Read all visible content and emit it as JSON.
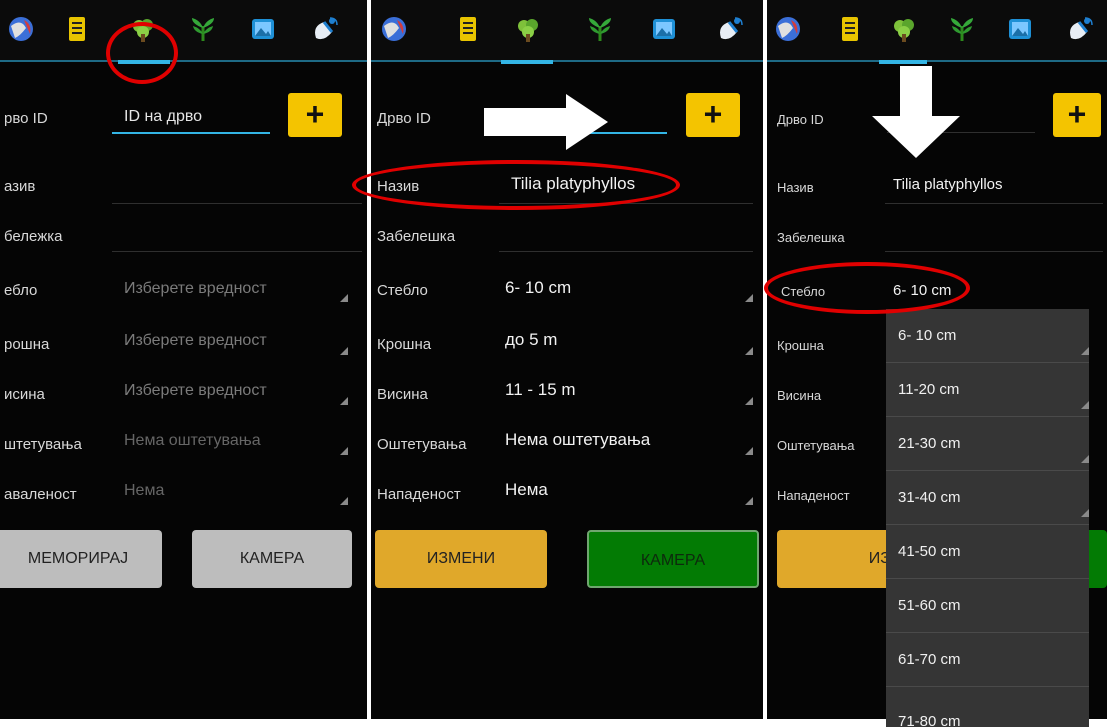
{
  "colors": {
    "accent": "#33b5e5",
    "plus": "#f4c400",
    "yellow_button": "#e0a82a",
    "green_button": "#037b04",
    "grey_button": "#bdbdbd",
    "highlight": "#e00000"
  },
  "tabs": [
    {
      "name": "globe-icon"
    },
    {
      "name": "notes-icon"
    },
    {
      "name": "tree-leaf-icon"
    },
    {
      "name": "plant-icon"
    },
    {
      "name": "image-icon"
    },
    {
      "name": "satellite-icon"
    }
  ],
  "panels": [
    {
      "labels": {
        "tree_id": "рво ID",
        "name": "азив",
        "note": "бележка",
        "trunk": "ебло",
        "crown": "рошна",
        "height": "исина",
        "damage": "штетувања",
        "infestation": "аваленост"
      },
      "tree_id_placeholder": "ID на дрво",
      "name_value": "",
      "trunk_placeholder": "Изберете вредност",
      "crown_placeholder": "Изберете вредност",
      "height_placeholder": "Изберете вредност",
      "damage_placeholder": "Нема оштетувања",
      "infestation_placeholder": "Нема",
      "buttons": {
        "left": "МЕМОРИРАЈ",
        "right": "КАМЕРА"
      }
    },
    {
      "labels": {
        "tree_id": "Дрво ID",
        "name": "Назив",
        "note": "Забелешка",
        "trunk": "Стебло",
        "crown": "Крошна",
        "height": "Висина",
        "damage": "Оштетувања",
        "infestation": "Нападеност"
      },
      "name_value": "Tilia platyphyllos",
      "trunk_value": "6- 10 cm",
      "crown_value": "до 5 m",
      "height_value": "11 - 15 m",
      "damage_value": "Нема оштетувања",
      "infestation_value": "Нема",
      "buttons": {
        "left": "ИЗМЕНИ",
        "right": "КАМЕРА"
      }
    },
    {
      "labels": {
        "tree_id": "Дрво ID",
        "name": "Назив",
        "note": "Забелешка",
        "trunk": "Стебло",
        "crown": "Крошна",
        "height": "Висина",
        "damage": "Оштетувања",
        "infestation": "Нападеност"
      },
      "name_value": "Tilia platyphyllos",
      "trunk_value": "6- 10 cm",
      "buttons": {
        "left": "ИЗМЕНИ"
      },
      "dropdown_options": [
        "6- 10 cm",
        "11-20 cm",
        "21-30 cm",
        "31-40 cm",
        "41-50 cm",
        "51-60 cm",
        "61-70 cm",
        "71-80 cm"
      ]
    }
  ]
}
